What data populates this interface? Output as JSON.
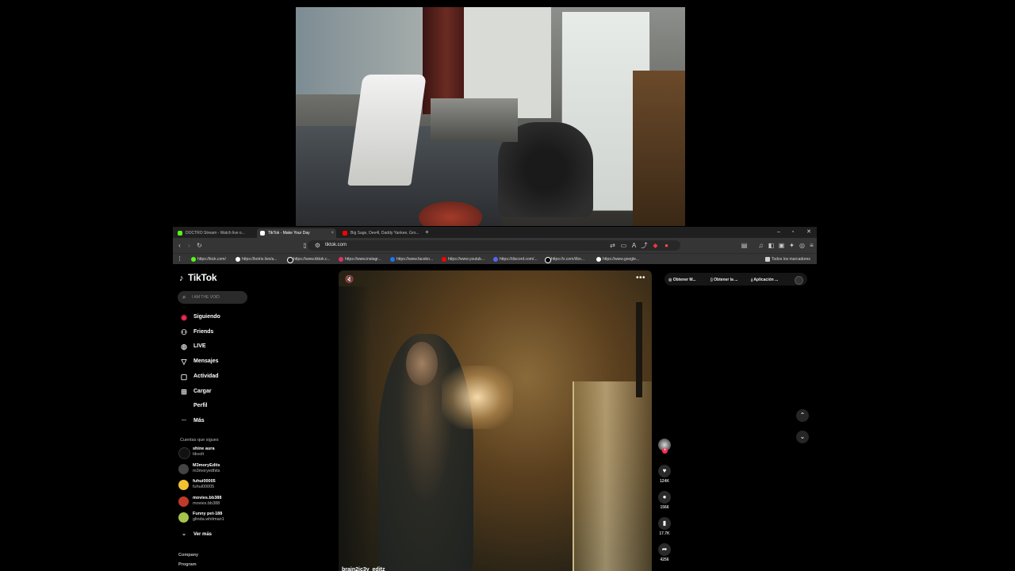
{
  "tabs": [
    {
      "title": "DOCTRO Stream - Watch live o...",
      "color": "#53fc18"
    },
    {
      "title": "TikTok - Make Your Day",
      "color": "#ffffff"
    },
    {
      "title": "Big Sage, Dee4l, Daddy Yankee, Gro...",
      "color": "#ff0000"
    }
  ],
  "browser": {
    "url": "tiktok.com",
    "new_tab": "+",
    "bookmarks": [
      {
        "label": "https://kick.com/",
        "color": "#53fc18"
      },
      {
        "label": "https://botrix.live/a...",
        "color": "#ffffff"
      },
      {
        "label": "https://www.tiktok.c...",
        "color": "#111111"
      },
      {
        "label": "https://www.instagr...",
        "color": "#e1306c"
      },
      {
        "label": "https://www.facebo...",
        "color": "#1877f2"
      },
      {
        "label": "https://www.youtub...",
        "color": "#ff0000"
      },
      {
        "label": "https://discord.com/...",
        "color": "#5865f2"
      },
      {
        "label": "https://x.com/i/bo...",
        "color": "#000000"
      },
      {
        "label": "https://www.google...",
        "color": "#ffffff"
      }
    ],
    "all_bookmarks": "Todos los marcadores"
  },
  "tiktok": {
    "brand": "TikTok",
    "search_placeholder": "I AM THE VOID",
    "nav": [
      {
        "label": "Siguiendo",
        "icon": "following-icon"
      },
      {
        "label": "Friends",
        "icon": "friends-icon"
      },
      {
        "label": "LIVE",
        "icon": "live-icon"
      },
      {
        "label": "Mensajes",
        "icon": "messages-icon"
      },
      {
        "label": "Actividad",
        "icon": "activity-icon"
      },
      {
        "label": "Cargar",
        "icon": "upload-icon"
      },
      {
        "label": "Perfil",
        "icon": "profile-icon"
      },
      {
        "label": "Más",
        "icon": "more-icon"
      }
    ],
    "following_title": "Cuentas que sigues",
    "following": [
      {
        "name": "shine aura",
        "handle": "tikvolt",
        "color": "#111111"
      },
      {
        "name": "M3moryEdits",
        "handle": "m3moryedhits",
        "color": "#444444"
      },
      {
        "name": "fuhui00005",
        "handle": "fuhui00005",
        "color": "#f2c230"
      },
      {
        "name": "movies.bb388",
        "handle": "movies.bb388",
        "color": "#c0392b"
      },
      {
        "name": "Funny pet-188",
        "handle": "glinda.whitman1",
        "color": "#a6c34a"
      }
    ],
    "see_more": "Ver más",
    "footer": [
      "Company",
      "Program"
    ],
    "video": {
      "author": "brain2ic3y_editz"
    },
    "actions": [
      {
        "icon": "heart-icon",
        "glyph": "♥",
        "count": "124K"
      },
      {
        "icon": "comment-icon",
        "glyph": "●",
        "count": "1566"
      },
      {
        "icon": "bookmark-icon",
        "glyph": "▮",
        "count": "17.7K"
      },
      {
        "icon": "share-icon",
        "glyph": "➦",
        "count": "4256"
      }
    ],
    "top_pills": [
      "Obtener M...",
      "Obtener la ...",
      "Aplicación ..."
    ]
  }
}
